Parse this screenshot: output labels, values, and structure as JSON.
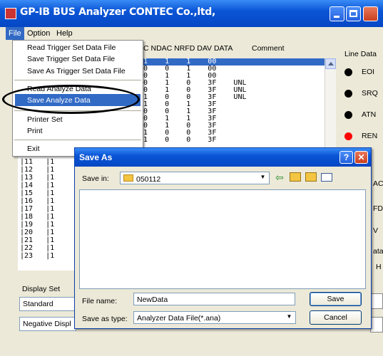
{
  "window": {
    "title": "GP-IB BUS Analyzer CONTEC Co.,ltd,"
  },
  "menubar": [
    "File",
    "Option",
    "Help"
  ],
  "file_menu": {
    "items": [
      "Read Trigger Set Data File",
      "Save Trigger Set Data File",
      "Save As Trigger Set Data File",
      "Read Analyze Data",
      "Save Analyze Data",
      "Printer Set",
      "Print",
      "Exit"
    ],
    "selected": "Save Analyze Data"
  },
  "trace": {
    "header": "C NDAC NRFD DAV DATA",
    "comment_header": "Comment",
    "rows": [
      "1    1    1    00",
      "0    0    1    00",
      "0    1    1    00",
      "0    1    0    3F    UNL",
      "0    1    0    3F    UNL",
      "1    0    0    3F    UNL",
      "1    0    1    3F",
      "0    0    1    3F",
      "0    1    1    3F",
      "0    1    0    3F",
      "1    0    0    3F",
      "1    0    0    3F",
      "1    0    1    3F"
    ]
  },
  "line_data": {
    "title": "Line Data",
    "lines": [
      {
        "label": "EOI",
        "color": "#000000"
      },
      {
        "label": "SRQ",
        "color": "#000000"
      },
      {
        "label": "ATN",
        "color": "#000000"
      },
      {
        "label": "REN",
        "color": "#ff0000"
      }
    ]
  },
  "lower_list": {
    "rows": [
      {
        "idx": "|11",
        "v": "|1"
      },
      {
        "idx": "|12",
        "v": "|1"
      },
      {
        "idx": "|13",
        "v": "|1"
      },
      {
        "idx": "|14",
        "v": "|1"
      },
      {
        "idx": "|15",
        "v": "|1"
      },
      {
        "idx": "|16",
        "v": "|1"
      },
      {
        "idx": "|17",
        "v": "|1"
      },
      {
        "idx": "|18",
        "v": "|1"
      },
      {
        "idx": "|19",
        "v": "|1"
      },
      {
        "idx": "|20",
        "v": "|1"
      },
      {
        "idx": "|21",
        "v": "|1"
      },
      {
        "idx": "|22",
        "v": "|1"
      },
      {
        "idx": "|23",
        "v": "|1"
      }
    ]
  },
  "display_set": {
    "label": "Display Set",
    "value": "Standard",
    "negative": "Negative Displ"
  },
  "right_edge": [
    "AC",
    "FD",
    "V",
    "ata",
    "H"
  ],
  "dialog": {
    "title": "Save As",
    "save_in_label": "Save in:",
    "save_in_value": "050112",
    "file_name_label": "File name:",
    "file_name_value": "NewData",
    "save_type_label": "Save as type:",
    "save_type_value": "Analyzer Data File(*.ana)",
    "save_button": "Save",
    "cancel_button": "Cancel"
  }
}
